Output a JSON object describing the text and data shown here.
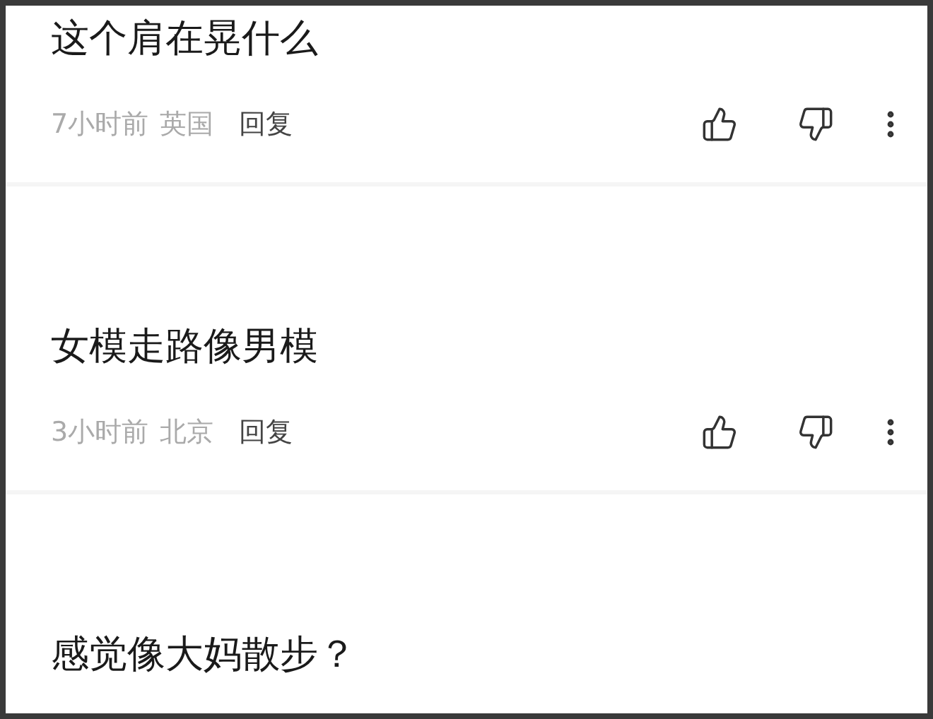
{
  "comments": [
    {
      "text": "这个肩在晃什么",
      "time": "7小时前",
      "location": "英国",
      "reply_label": "回复"
    },
    {
      "text": "女模走路像男模",
      "time": "3小时前",
      "location": "北京",
      "reply_label": "回复"
    },
    {
      "text": "感觉像大妈散步？"
    }
  ]
}
